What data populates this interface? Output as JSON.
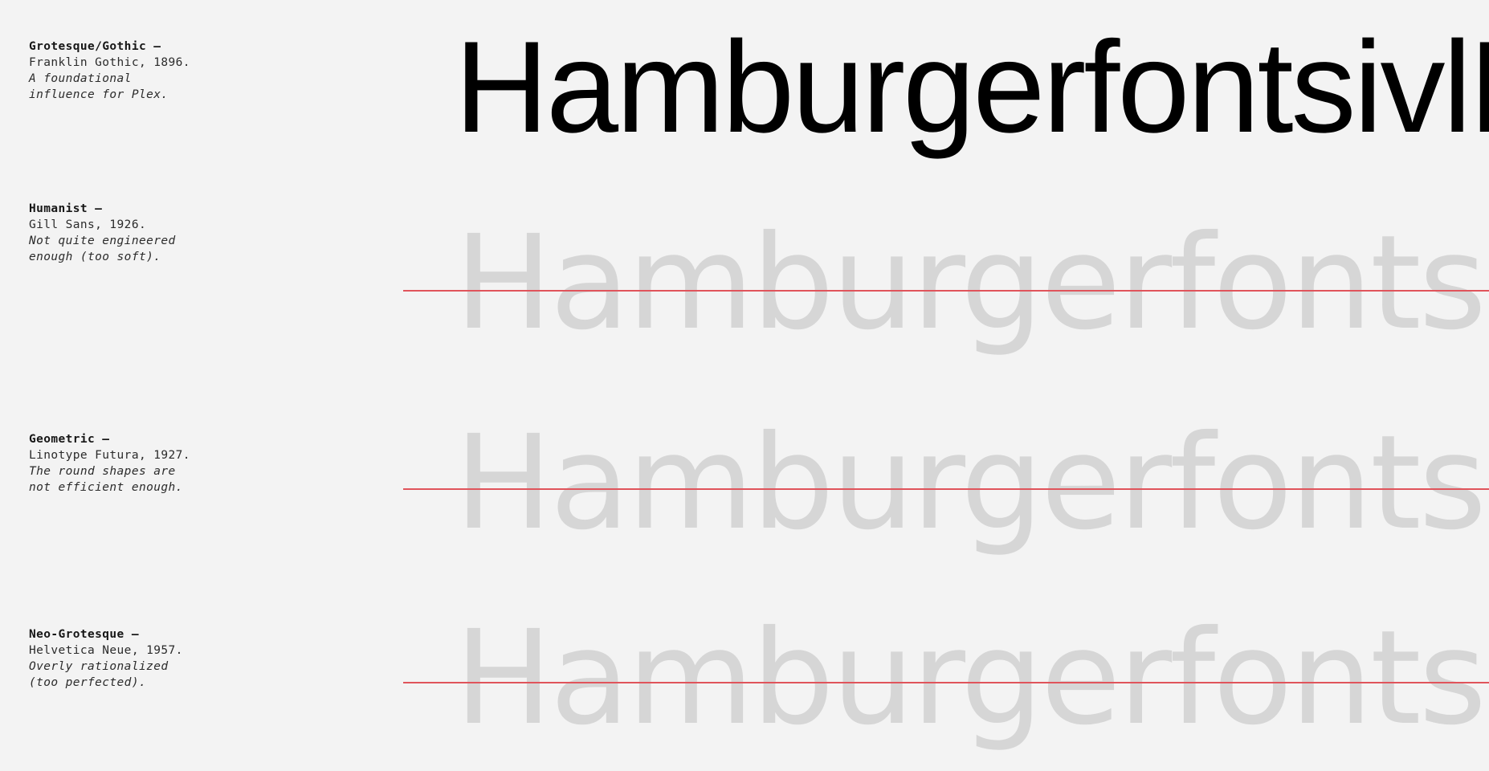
{
  "colors": {
    "background": "#f3f3f3",
    "primary_sample": "#000000",
    "rejected_sample": "#d6d6d6",
    "strike_line": "#e0545b"
  },
  "sample_word": "HamburgerfontsivlB",
  "rows": [
    {
      "category": "Grotesque/Gothic —",
      "reference": "Franklin Gothic, 1896.",
      "note_line1": "A foundational",
      "note_line2": "influence for Plex.",
      "rejected": false
    },
    {
      "category": "Humanist —",
      "reference": "Gill Sans, 1926.",
      "note_line1": "Not quite engineered",
      "note_line2": "enough (too soft).",
      "rejected": true
    },
    {
      "category": "Geometric —",
      "reference": "Linotype Futura, 1927.",
      "note_line1": "The round shapes are",
      "note_line2": "not efficient enough.",
      "rejected": true
    },
    {
      "category": "Neo-Grotesque —",
      "reference": "Helvetica Neue, 1957.",
      "note_line1": "Overly rationalized",
      "note_line2": "(too perfected).",
      "rejected": true
    }
  ]
}
